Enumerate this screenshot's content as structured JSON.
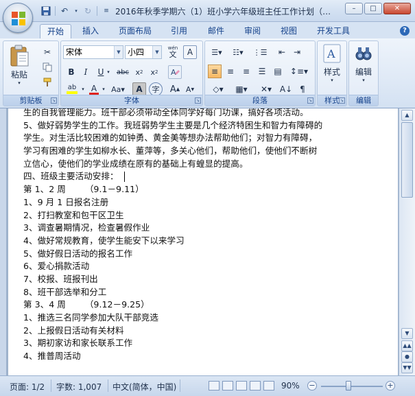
{
  "window": {
    "title": "2016年秋季学期六（1）班小学六年级班主任工作计划（…",
    "controls": {
      "minimize": "–",
      "maximize": "□",
      "close": "✕"
    }
  },
  "quick_access": {
    "save_icon": "save-icon",
    "undo_icon": "undo-icon",
    "redo_icon": "redo-icon",
    "customize_icon": "customize-icon"
  },
  "tabs": [
    {
      "label": "开始",
      "active": true
    },
    {
      "label": "插入"
    },
    {
      "label": "页面布局"
    },
    {
      "label": "引用"
    },
    {
      "label": "邮件"
    },
    {
      "label": "审阅"
    },
    {
      "label": "视图"
    },
    {
      "label": "开发工具"
    }
  ],
  "ribbon": {
    "clipboard": {
      "label": "剪贴板",
      "paste": "粘贴"
    },
    "font": {
      "label": "字体",
      "font_name": "宋体",
      "font_size": "小四",
      "wen": "wén",
      "wen_char": "文"
    },
    "paragraph": {
      "label": "段落"
    },
    "styles": {
      "label": "样式"
    },
    "editing": {
      "label": "编辑"
    }
  },
  "document": {
    "lines": [
      "生的自我管理能力。班干部必须带动全体同学好每门功课，搞好各项活动。",
      "5、做好弱势学生的工作。我班弱势学生主要是几个经济特困生和智力有障碍的",
      "学生。对生活比较困难的如钟勇、黄金美等想办法帮助他们；对智力有障碍，",
      "学习有困难的学生如柳水长、董萍等，多关心他们，帮助他们，使他们不断树",
      "立信心，使他们的学业成绩在原有的基础上有蝗显的提高。",
      "四、班级主要活动安排：",
      "第 1、2 周       （9.1－9.11）",
      "1、9 月 1 日报名注册",
      "2、打扫教室和包干区卫生",
      "3、调查暑期情况，检查暑假作业",
      "4、做好常规教育，使学生能安下以来学习",
      "5、做好假日活动的报名工作",
      "6、爱心捐款活动",
      "7、校报、班报刊出",
      "8、班干部选举和分工",
      "第 3、4 周       （9.12－9.25）",
      "1、推选三名同学参加大队干部竞选",
      "2、上报假日活动有关材料",
      "3、期初家访和家长联系工作",
      "4、推普周活动"
    ]
  },
  "statusbar": {
    "page": "页面: 1/2",
    "words": "字数: 1,007",
    "language": "中文(简体，中国)",
    "zoom": "90%",
    "zoom_level": 0.9
  }
}
